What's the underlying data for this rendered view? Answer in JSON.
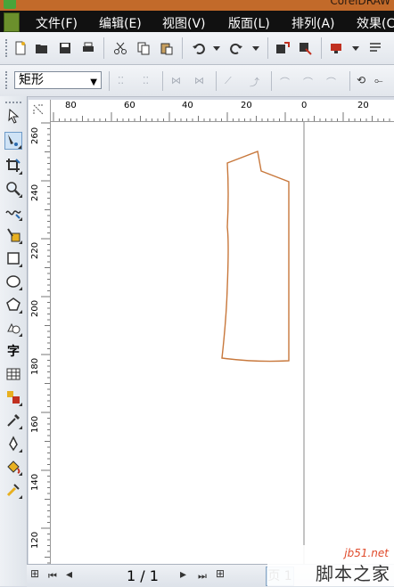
{
  "window": {
    "title_fragment": "CorelDRAW"
  },
  "menu": [
    {
      "label": "文件(F)"
    },
    {
      "label": "编辑(E)"
    },
    {
      "label": "视图(V)"
    },
    {
      "label": "版面(L)"
    },
    {
      "label": "排列(A)"
    },
    {
      "label": "效果(C"
    }
  ],
  "property_bar": {
    "object_type": "矩形"
  },
  "ruler": {
    "horizontal_ticks": [
      "80",
      "60",
      "40",
      "20",
      "0",
      "20"
    ],
    "vertical_ticks": [
      "260",
      "240",
      "220",
      "200",
      "180",
      "160",
      "140",
      "120"
    ]
  },
  "status": {
    "page_counter": "1 / 1",
    "page_tab": "页 1"
  },
  "watermark": {
    "site": "jb51.net",
    "name": "脚本之家"
  },
  "colors": {
    "outline": "#c8783c",
    "menubar": "#111111",
    "guide": "#888888"
  },
  "tools": [
    "pick-tool-icon",
    "shape-tool-icon",
    "crop-tool-icon",
    "zoom-tool-icon",
    "freehand-tool-icon",
    "smart-fill-icon",
    "rectangle-tool-icon",
    "ellipse-tool-icon",
    "polygon-tool-icon",
    "basic-shapes-icon",
    "text-tool-icon",
    "table-tool-icon",
    "interactive-blend-icon",
    "eyedropper-tool-icon",
    "outline-pen-icon",
    "fill-tool-icon",
    "interactive-fill-icon"
  ]
}
